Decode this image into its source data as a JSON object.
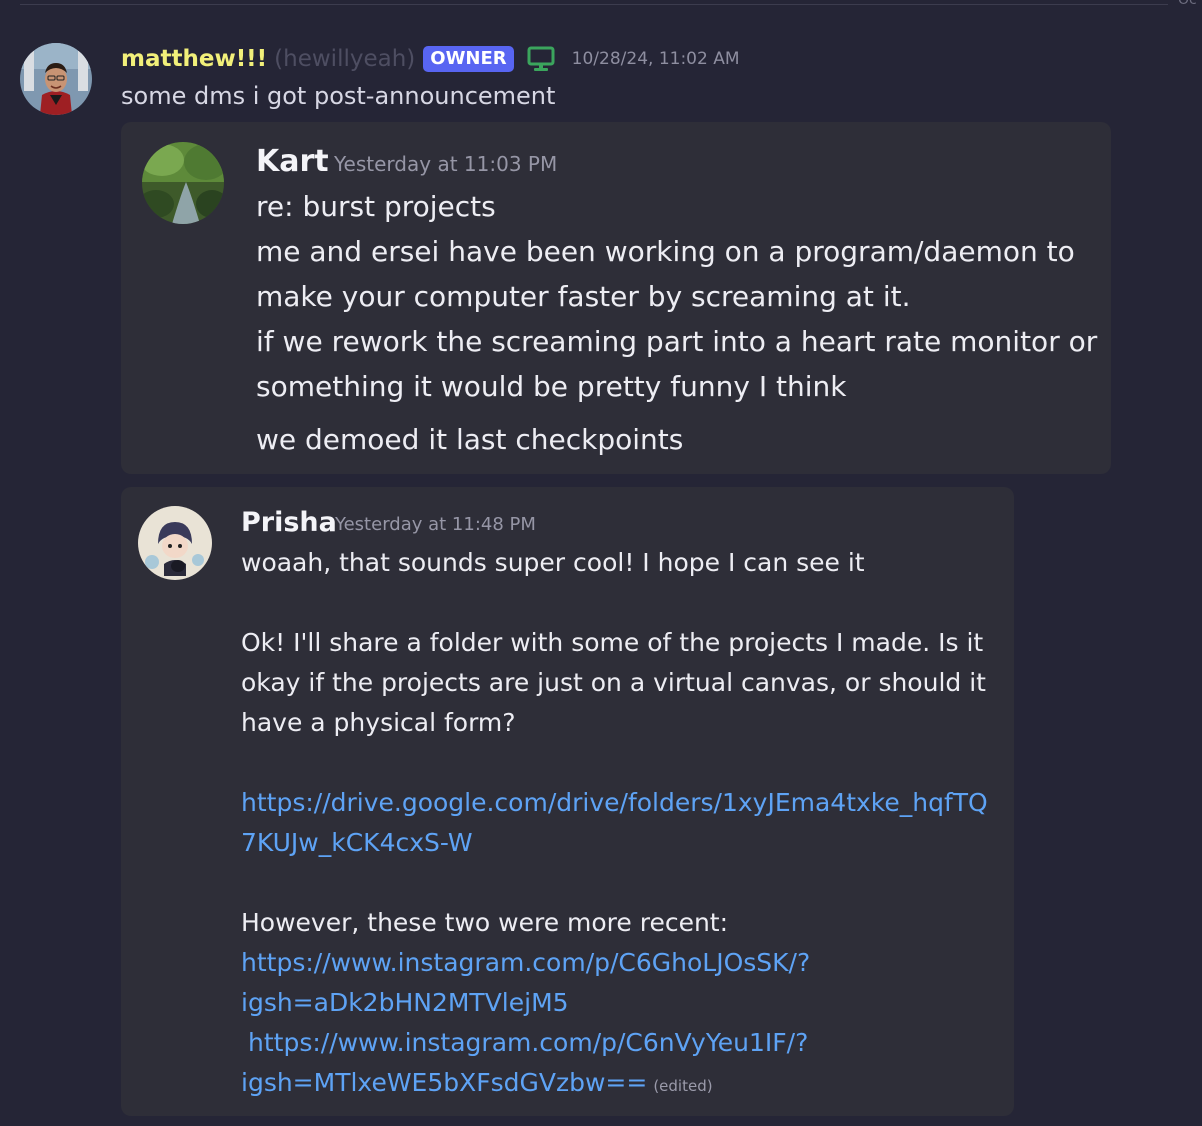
{
  "divider_date": "Oc",
  "message": {
    "username": "matthew!!!",
    "handle": "(hewillyeah)",
    "badge": "OWNER",
    "device_icon": "desktop-icon",
    "timestamp": "10/28/24, 11:02 AM",
    "text": "some dms i got post-announcement"
  },
  "embeds": [
    {
      "author": "Kart",
      "time": "Yesterday at 11:03 PM",
      "lines": [
        "re: burst projects",
        "me and ersei have been working on a program/daemon to",
        "make your computer faster by screaming at it.",
        "if we rework the screaming part into a heart rate monitor or",
        "something it would be pretty funny I think",
        "we demoed it last checkpoints"
      ]
    },
    {
      "author": "Prisha",
      "time": "Yesterday at 11:48 PM",
      "line1": "woaah, that sounds super cool! I hope I can see it",
      "para2": [
        "Ok! I'll share a folder with some of the projects I made. Is it",
        "okay if the projects are just on a virtual canvas, or should it",
        "have a physical form?"
      ],
      "drive_link": [
        "https://drive.google.com/drive/folders/1xyJEma4txke_hqfTQ",
        "7KUJw_kCK4cxS-W"
      ],
      "recent_text": "However, these two were more recent:",
      "insta_link1": [
        "https://www.instagram.com/p/C6GhoLJOsSK/?",
        "igsh=aDk2bHN2MTVlejM5"
      ],
      "insta_link2": [
        "https://www.instagram.com/p/C6nVyYeu1IF/?",
        "igsh=MTlxeWE5bXFsdGVzbw=="
      ],
      "edited": "(edited)"
    }
  ],
  "colors": {
    "background": "#252536",
    "card": "#2e2e38",
    "username": "#f2f07a",
    "badge": "#5865f2",
    "link": "#5ea3f5",
    "device_icon": "#3ba55d"
  }
}
